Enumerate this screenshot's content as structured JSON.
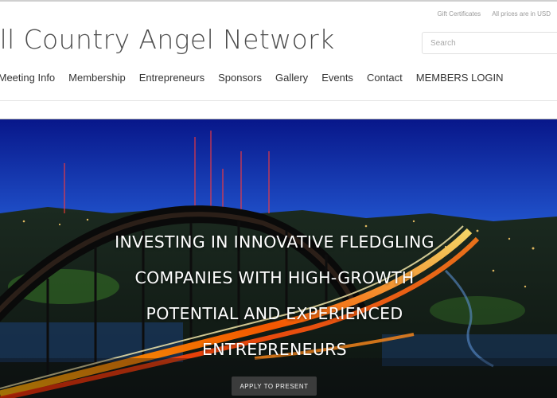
{
  "utility": {
    "gift_certificates": "Gift Certificates",
    "prices_note": "All prices are in USD"
  },
  "site": {
    "title": "ill Country Angel Network"
  },
  "search": {
    "placeholder": "Search"
  },
  "nav": {
    "items": [
      "/Meeting Info",
      "Membership",
      "Entrepreneurs",
      "Sponsors",
      "Gallery",
      "Events",
      "Contact",
      "MEMBERS LOGIN"
    ]
  },
  "hero": {
    "lines": [
      "INVESTING IN INNOVATIVE FLEDGLING",
      "COMPANIES WITH HIGH-GROWTH",
      "POTENTIAL AND EXPERIENCED",
      "ENTREPRENEURS"
    ],
    "button_label": "APPLY TO PRESENT",
    "image_subject": "night-bridge-cityscape"
  },
  "colors": {
    "title": "#4c4c4c",
    "nav_text": "#333333",
    "sky_top": "#0a1f8c",
    "sky_mid": "#3a6fd6",
    "button_bg": "#464646"
  }
}
